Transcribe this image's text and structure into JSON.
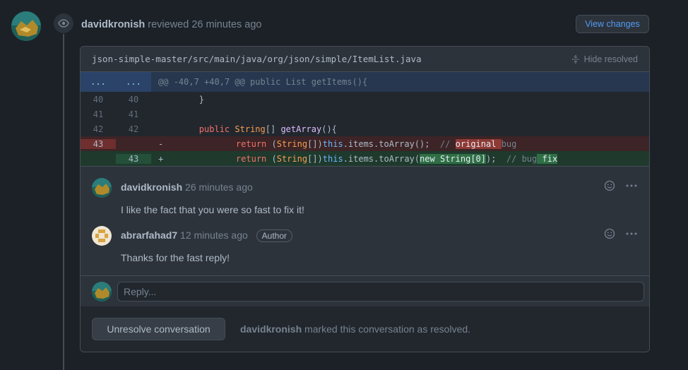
{
  "review": {
    "author": "davidkronish",
    "action_text": "reviewed 26 minutes ago",
    "view_changes_label": "View changes"
  },
  "file": {
    "path": "json-simple-master/src/main/java/org/json/simple/ItemList.java",
    "hide_resolved_label": "Hide resolved",
    "hunk": {
      "ln_old": "...",
      "ln_new": "...",
      "text": "@@ -40,7 +40,7 @@ public List getItems(){"
    },
    "lines": [
      {
        "old": "40",
        "new": "40",
        "sign": "",
        "code": "        }"
      },
      {
        "old": "41",
        "new": "41",
        "sign": "",
        "code": ""
      },
      {
        "old": "42",
        "new": "42",
        "sign": "",
        "code": "        public String[] getArray(){"
      },
      {
        "old": "43",
        "new": "",
        "sign": "-",
        "code": "                return (String[])this.items.toArray();  // original bug"
      },
      {
        "old": "",
        "new": "43",
        "sign": "+",
        "code": "                return (String[])this.items.toArray(new String[0]);  // bug fix"
      }
    ]
  },
  "comments": [
    {
      "author": "davidkronish",
      "time": "26 minutes ago",
      "body": "I like the fact that you were so fast to fix it!",
      "badge": ""
    },
    {
      "author": "abrarfahad7",
      "time": "12 minutes ago",
      "body": "Thanks for the fast reply!",
      "badge": "Author"
    }
  ],
  "reply": {
    "placeholder": "Reply..."
  },
  "footer": {
    "unresolve_label": "Unresolve conversation",
    "resolver": "davidkronish",
    "resolved_text": "marked this conversation as resolved."
  },
  "icons": {
    "eye": "eye-icon",
    "fold": "fold-icon",
    "emoji": "smiley-icon",
    "more": "kebab-horizontal-icon"
  },
  "colors": {
    "background": "#1c2128",
    "link": "#539bf5",
    "deletion": "#6e2f2e",
    "addition": "#24503a"
  }
}
